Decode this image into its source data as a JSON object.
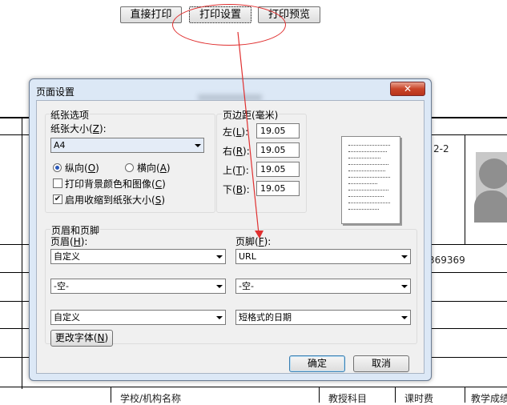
{
  "toolbar": {
    "print_direct": "直接打印",
    "print_setup": "打印设置",
    "print_preview": "打印预览"
  },
  "background": {
    "text_2_2": "2-2",
    "text_369": "369369",
    "footer_cell_1": "学校/机构名称",
    "footer_cell_2": "教授科目",
    "footer_cell_3": "课时费",
    "footer_cell_4": "教学成绩"
  },
  "dialog": {
    "title": "页面设置",
    "close_glyph": "✕",
    "paper": {
      "group_label": "纸张选项",
      "size_label": "纸张大小",
      "size_hotkey": "Z",
      "size_value": "A4",
      "portrait_label": "纵向",
      "portrait_hotkey": "O",
      "landscape_label": "横向",
      "landscape_hotkey": "A",
      "print_bg_label": "打印背景颜色和图像",
      "print_bg_hotkey": "C",
      "shrink_label": "启用收缩到纸张大小",
      "shrink_hotkey": "S",
      "portrait_selected": true,
      "print_bg_checked": false,
      "shrink_checked": true
    },
    "margins": {
      "group_label": "页边距(毫米)",
      "left_label": "左",
      "left_hotkey": "L",
      "left_value": "19.05",
      "right_label": "右",
      "right_hotkey": "R",
      "right_value": "19.05",
      "top_label": "上",
      "top_hotkey": "T",
      "top_value": "19.05",
      "bottom_label": "下",
      "bottom_hotkey": "B",
      "bottom_value": "19.05"
    },
    "header_footer": {
      "group_label": "页眉和页脚",
      "header_label": "页眉",
      "header_hotkey": "H",
      "footer_label": "页脚",
      "footer_hotkey": "F",
      "header_1": "自定义",
      "header_2": "-空-",
      "header_3": "自定义",
      "footer_1": "URL",
      "footer_2": "-空-",
      "footer_3": "短格式的日期",
      "change_font_label": "更改字体",
      "change_font_hotkey": "N"
    },
    "ok_label": "确定",
    "cancel_label": "取消"
  },
  "colors": {
    "annotation": "#e03030",
    "dialog_frame": "#dce8f6",
    "client_bg": "#f0f0f0"
  }
}
